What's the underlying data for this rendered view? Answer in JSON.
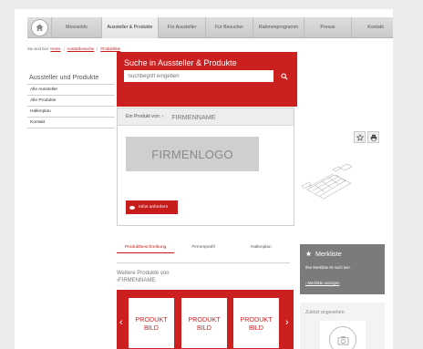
{
  "nav": {
    "items": [
      {
        "label": "Messeinfo"
      },
      {
        "label": "Aussteller & Produkte"
      },
      {
        "label": "Für Aussteller"
      },
      {
        "label": "Für Besucher"
      },
      {
        "label": "Rahmenprogramm"
      },
      {
        "label": "Presse"
      },
      {
        "label": "Kontakt"
      }
    ]
  },
  "breadcrumb": {
    "prefix": "Sie sind hier:",
    "items": [
      "Home",
      "Ausstellersuche",
      "Produktliste"
    ]
  },
  "sidebar": {
    "title": "Aussteller und Produkte",
    "items": [
      {
        "label": "Alle Aussteller"
      },
      {
        "label": "Alle Produkte"
      },
      {
        "label": "Hallenplan"
      },
      {
        "label": "Kontakt"
      }
    ]
  },
  "search": {
    "title": "Suche in Aussteller & Produkte",
    "placeholder": "Suchbegriff eingeben"
  },
  "detail": {
    "product_from": "Ein Produkt von: ›",
    "firm_name": "FIRMENNAME",
    "logo_text": "FIRMENLOGO",
    "info_button": "Infos anfordern"
  },
  "tabs": [
    {
      "label": "Produktbeschreibung"
    },
    {
      "label": "Firmenprofil"
    },
    {
      "label": "Hallenplan"
    }
  ],
  "more_products": {
    "line1": "Weitere Produkte von",
    "line2": "›FIRMENNAME",
    "items": [
      {
        "line1": "PRODUKT",
        "line2": "BILD"
      },
      {
        "line1": "PRODUKT",
        "line2": "BILD"
      },
      {
        "line1": "PRODUKT",
        "line2": "BILD"
      }
    ]
  },
  "merkliste": {
    "title": "Merkliste",
    "empty": "Ihre Merkliste ist noch leer.",
    "show_link": "› Merkliste anzeigen"
  },
  "recent": {
    "title": "Zuletzt angesehen"
  },
  "colors": {
    "brand_red": "#cc1f1f",
    "merk_gray": "#7b7b7b"
  },
  "icons": [
    "home-icon",
    "search-icon",
    "star-icon",
    "print-icon",
    "chat-icon",
    "camera-icon",
    "chevron-left-icon",
    "chevron-right-icon"
  ]
}
